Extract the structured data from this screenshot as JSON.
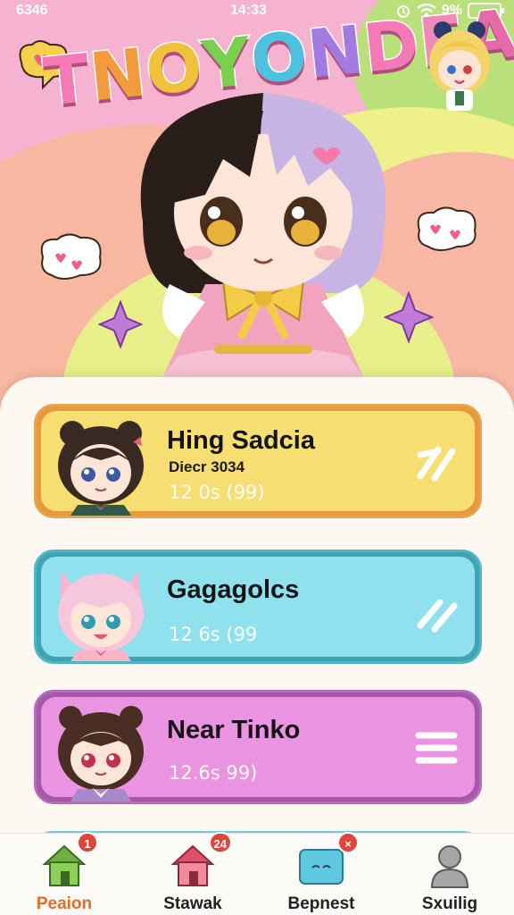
{
  "status_bar": {
    "carrier": "6346",
    "time": "14:33",
    "battery": "9%"
  },
  "app": {
    "title": "TNOYONDEA",
    "title_colors": [
      "#f37ab6",
      "#f39a3a",
      "#f0c23b",
      "#7bcf4e",
      "#4ec1e0",
      "#a37be0",
      "#f37ab6",
      "#f08ab9",
      "#e46aa8"
    ]
  },
  "cards": [
    {
      "name": "Hing Sadcia",
      "subtitle": "Diecr 3034",
      "meta": "12 0s (99)",
      "action_icon": "double-slash-icon",
      "avatar_icon": "bear-ear-girl-avatar"
    },
    {
      "name": "Gagagolcs",
      "subtitle": "",
      "meta": "12 6s (99",
      "action_icon": "double-slash-icon",
      "avatar_icon": "pink-cat-girl-avatar"
    },
    {
      "name": "Near Tinko",
      "subtitle": "",
      "meta": "12.6s 99)",
      "action_icon": "menu-lines-icon",
      "avatar_icon": "brown-bear-girl-avatar"
    }
  ],
  "nav": [
    {
      "label": "Peaion",
      "badge": "1",
      "icon": "home-icon",
      "active": true
    },
    {
      "label": "Stawak",
      "badge": "24",
      "icon": "home-icon",
      "active": false
    },
    {
      "label": "Bepnest",
      "badge": "×",
      "icon": "mail-box-icon",
      "active": false
    },
    {
      "label": "Sxuilig",
      "badge": "",
      "icon": "profile-icon",
      "active": false
    }
  ],
  "colors": {
    "nav_active": "#e56a2a",
    "card1": "#f7de72",
    "card2": "#8fe1ee",
    "card3": "#ea93e0",
    "badge": "#e0443a"
  }
}
